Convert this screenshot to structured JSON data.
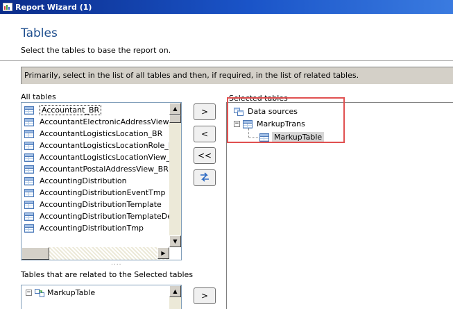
{
  "window": {
    "title": "Report Wizard (1)"
  },
  "header": {
    "title": "Tables",
    "subtitle": "Select the tables to base the report on."
  },
  "info": "Primarily, select in the list of all tables and then, if required, in the list of related tables.",
  "all_tables": {
    "label": "All tables",
    "items": [
      "Accountant_BR",
      "AccountantElectronicAddressView_",
      "AccountantLogisticsLocation_BR",
      "AccountantLogisticsLocationRole_E",
      "AccountantLogisticsLocationView_E",
      "AccountantPostalAddressView_BR",
      "AccountingDistribution",
      "AccountingDistributionEventTmp",
      "AccountingDistributionTemplate",
      "AccountingDistributionTemplateDet",
      "AccountingDistributionTmp"
    ]
  },
  "buttons": {
    "add": ">",
    "remove": "<",
    "remove_all": "<<",
    "add_related": ">"
  },
  "selected_tables": {
    "label": "Selected tables",
    "root": "Data sources",
    "parent": "MarkupTrans",
    "child": "MarkupTable"
  },
  "related": {
    "label": "Tables that are related to the Selected tables",
    "items": [
      "MarkupTable"
    ]
  },
  "splitter": "....",
  "colors": {
    "title_bar": "#1a54c8",
    "header_title": "#1f4f8e",
    "highlight": "#e05050"
  }
}
